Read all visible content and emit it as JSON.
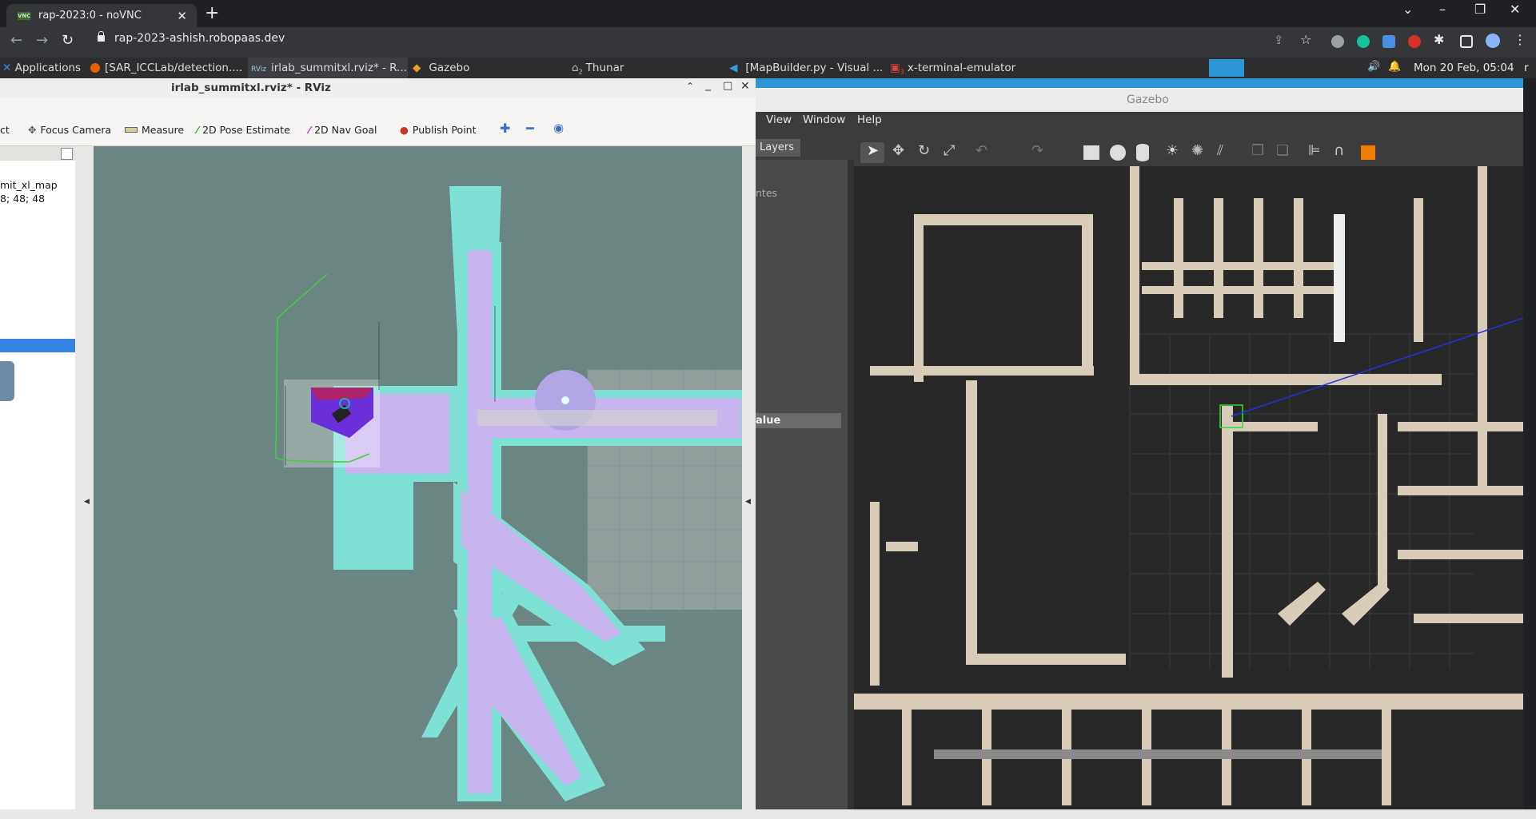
{
  "browser": {
    "tab_title": "rap-2023:0 - noVNC",
    "tab_favicon": "VNC",
    "url": "rap-2023-ashish.robopaas.dev"
  },
  "panel": {
    "applications": "Applications",
    "tasks": [
      {
        "label": "[SAR_ICCLab/detection...."
      },
      {
        "label": "irlab_summitxl.rviz* - R..."
      },
      {
        "label": "Gazebo"
      },
      {
        "label": "Thunar",
        "badge": "2"
      },
      {
        "label": "[MapBuilder.py - Visual ..."
      },
      {
        "label": "x-terminal-emulator",
        "badge": "3"
      }
    ],
    "clock": "Mon 20 Feb, 05:04",
    "clock_tail": "r"
  },
  "rviz": {
    "title": "irlab_summitxl.rviz* - RViz",
    "tools": [
      {
        "label": "ct"
      },
      {
        "label": "Focus Camera"
      },
      {
        "label": "Measure"
      },
      {
        "label": "2D Pose Estimate"
      },
      {
        "label": "2D Nav Goal"
      },
      {
        "label": "Publish Point"
      }
    ],
    "left_texts": [
      "mit_xl_map",
      "8; 48; 48"
    ]
  },
  "gazebo": {
    "title": "Gazebo",
    "menu": [
      "View",
      "Window",
      "Help"
    ],
    "layers_tab": "Layers",
    "partial_label": "ntes",
    "value_header": "alue"
  },
  "colors": {
    "chrome_bg": "#202124",
    "chrome_toolbar": "#35363a",
    "rviz_grid_bg": "#6b8582",
    "gazebo_blue": "#2c95d5",
    "costmap_cyan": "#7fe0d6",
    "costmap_violet": "#c9b6f0"
  }
}
